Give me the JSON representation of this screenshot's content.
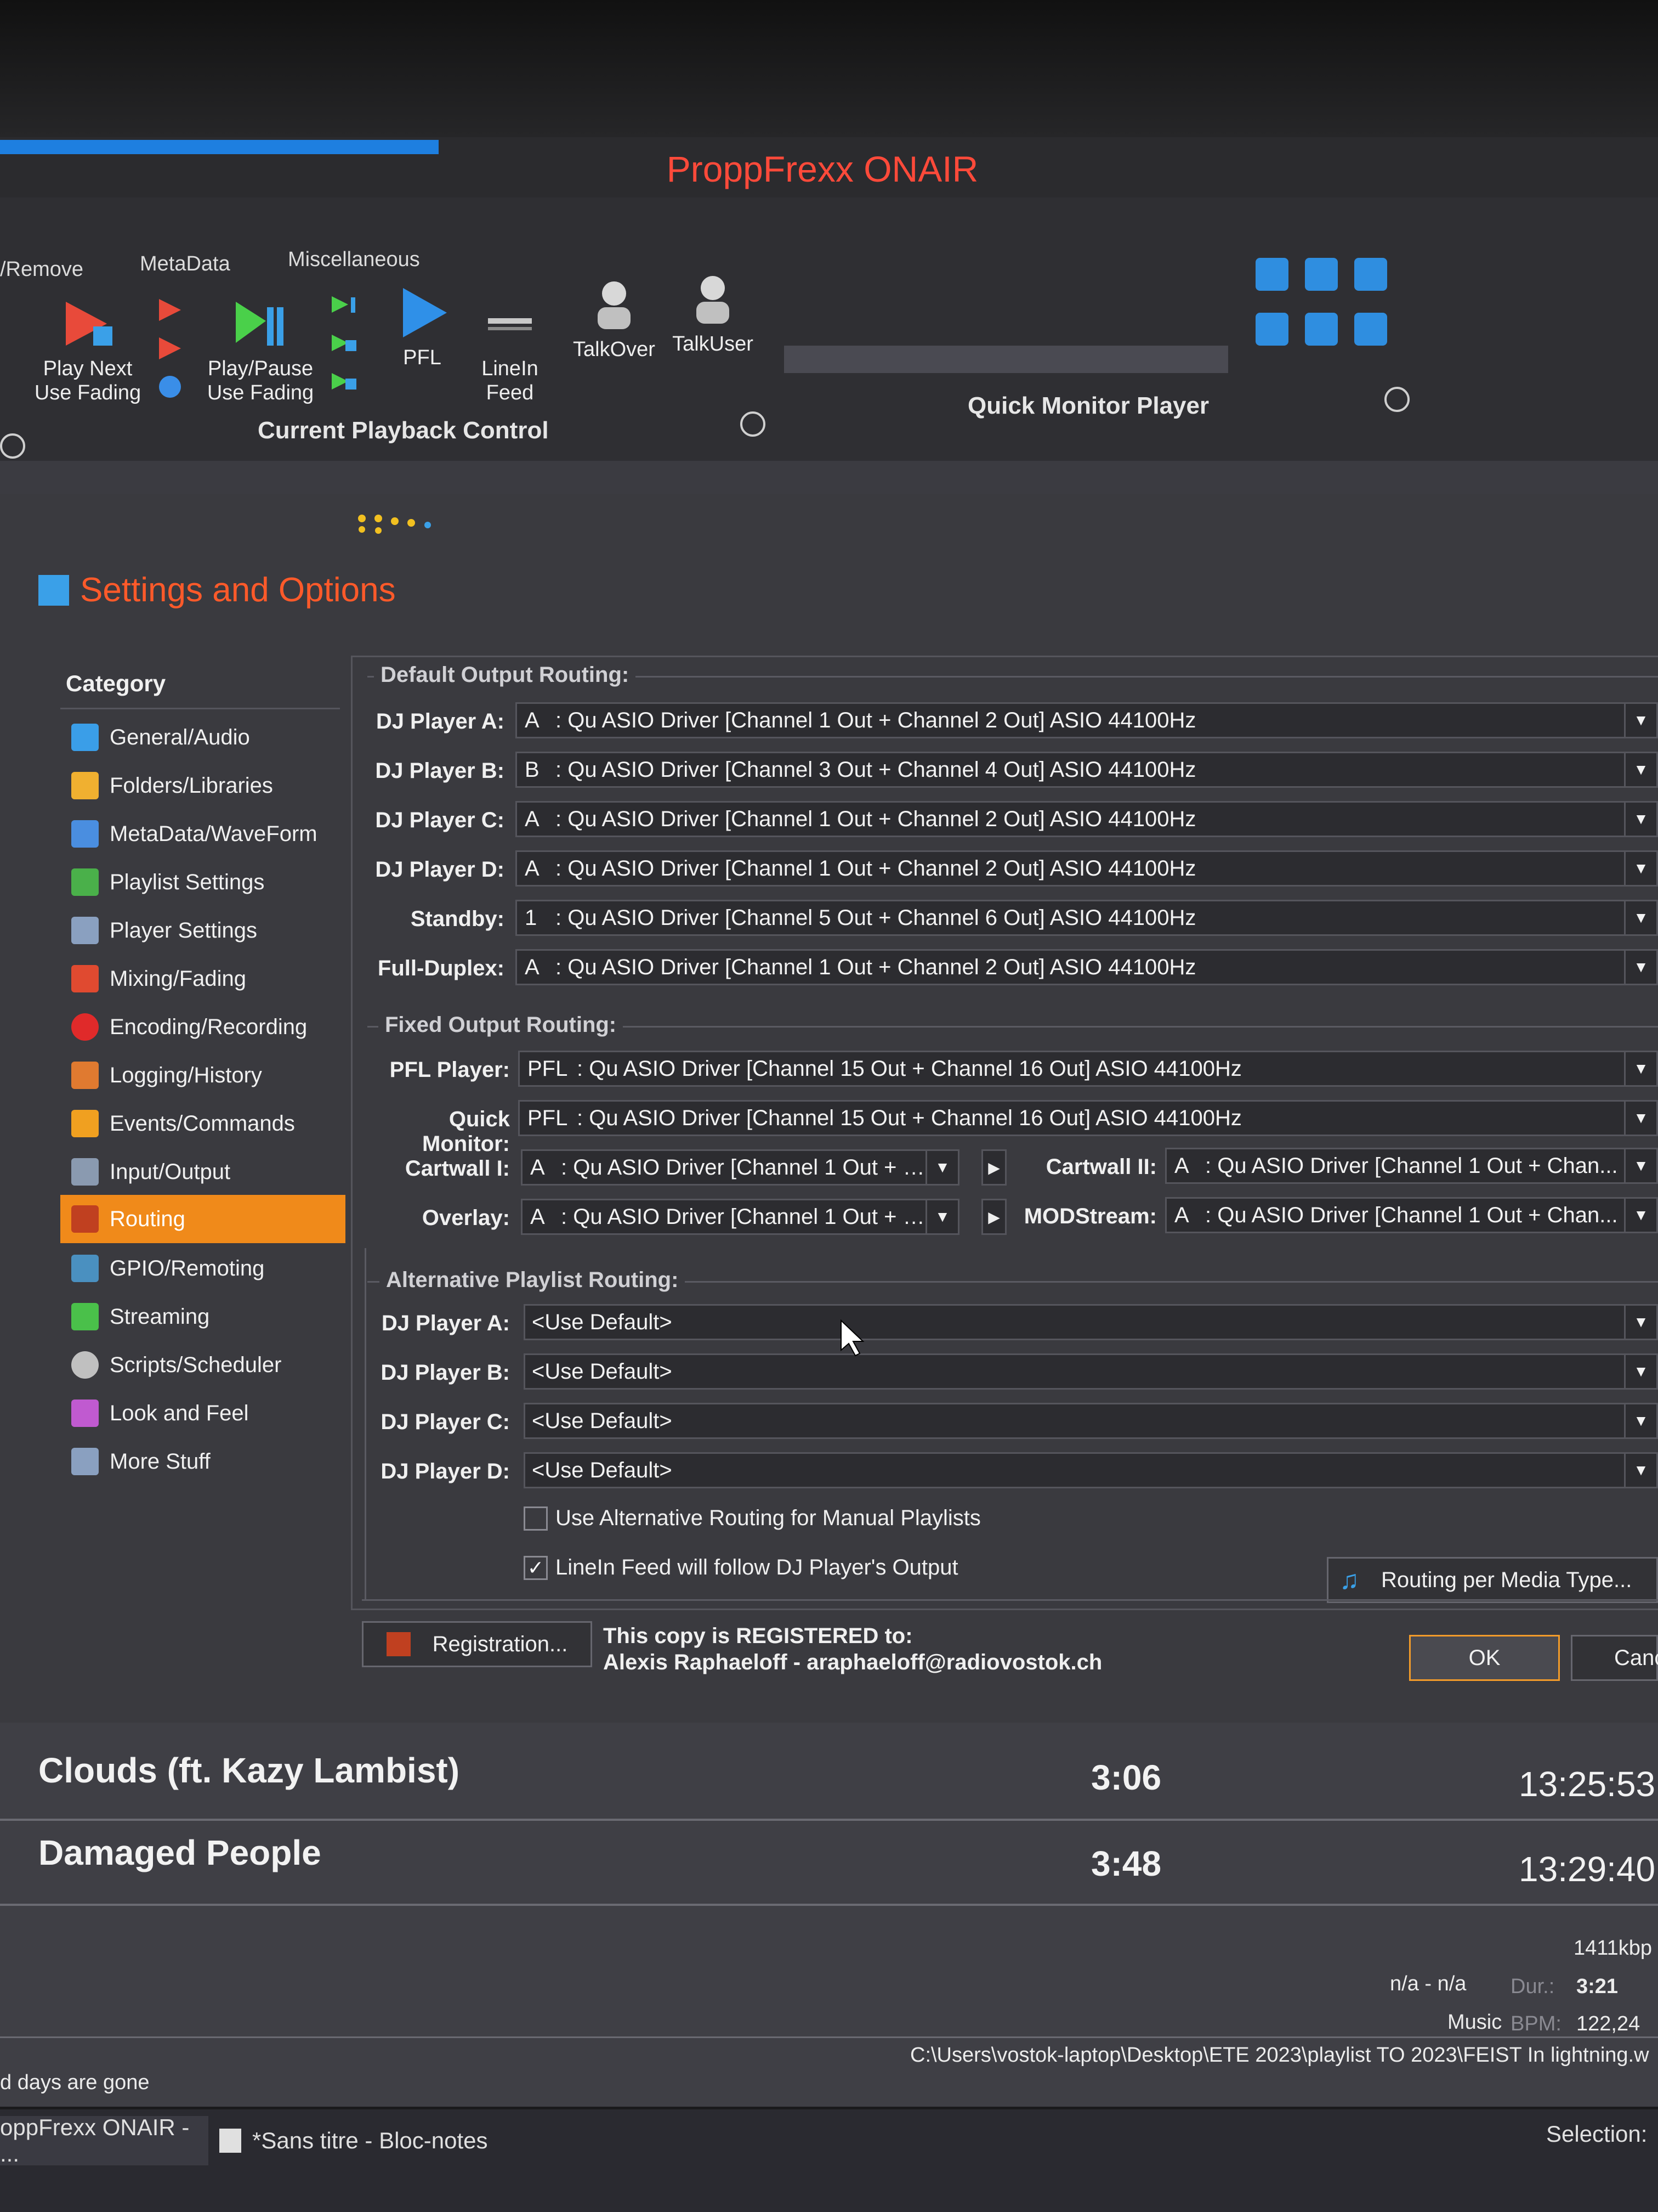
{
  "window": {
    "title": "ProppFrexx ONAIR"
  },
  "ribbon": {
    "group_labels": {
      "remove": "/Remove",
      "metadata": "MetaData",
      "misc": "Miscellaneous"
    },
    "buttons": {
      "play_next": "Play Next\nUse Fading",
      "play_pause": "Play/Pause\nUse Fading",
      "pfl": "PFL",
      "linein": "LineIn\nFeed",
      "talkover": "TalkOver",
      "talkuser": "TalkUser"
    },
    "sections": {
      "playback": "Current Playback Control",
      "monitor": "Quick Monitor Player"
    }
  },
  "settings": {
    "title": "Settings and Options",
    "category_header": "Category",
    "categories": [
      {
        "label": "General/Audio",
        "color": "#3a9ee8"
      },
      {
        "label": "Folders/Libraries",
        "color": "#f0b030"
      },
      {
        "label": "MetaData/WaveForm",
        "color": "#4a8ee0"
      },
      {
        "label": "Playlist Settings",
        "color": "#4ab04a"
      },
      {
        "label": "Player Settings",
        "color": "#8aa0c0"
      },
      {
        "label": "Mixing/Fading",
        "color": "#e04a30"
      },
      {
        "label": "Encoding/Recording",
        "color": "#e02a2a"
      },
      {
        "label": "Logging/History",
        "color": "#e07a30"
      },
      {
        "label": "Events/Commands",
        "color": "#f0a020"
      },
      {
        "label": "Input/Output",
        "color": "#8a9ab0"
      },
      {
        "label": "Routing",
        "color": "#c04020"
      },
      {
        "label": "GPIO/Remoting",
        "color": "#4a90c0"
      },
      {
        "label": "Streaming",
        "color": "#4ac04a"
      },
      {
        "label": "Scripts/Scheduler",
        "color": "#c0c0c0"
      },
      {
        "label": "Look and Feel",
        "color": "#c05ad0"
      },
      {
        "label": "More Stuff",
        "color": "#8aa0c0"
      }
    ],
    "active_category": "Routing",
    "default_output": {
      "title": "Default Output Routing:",
      "rows": [
        {
          "label": "DJ Player A:",
          "channel": "A",
          "value": ": Qu ASIO Driver [Channel 1 Out + Channel 2 Out] ASIO 44100Hz"
        },
        {
          "label": "DJ Player B:",
          "channel": "B",
          "value": ": Qu ASIO Driver [Channel 3 Out + Channel 4 Out] ASIO 44100Hz"
        },
        {
          "label": "DJ Player C:",
          "channel": "A",
          "value": ": Qu ASIO Driver [Channel 1 Out + Channel 2 Out] ASIO 44100Hz"
        },
        {
          "label": "DJ Player D:",
          "channel": "A",
          "value": ": Qu ASIO Driver [Channel 1 Out + Channel 2 Out] ASIO 44100Hz"
        },
        {
          "label": "Standby:",
          "channel": "1",
          "value": ": Qu ASIO Driver [Channel 5 Out + Channel 6 Out] ASIO 44100Hz"
        },
        {
          "label": "Full-Duplex:",
          "channel": "A",
          "value": ": Qu ASIO Driver [Channel 1 Out + Channel 2 Out] ASIO 44100Hz"
        }
      ]
    },
    "fixed_output": {
      "title": "Fixed Output Routing:",
      "pfl_label": "PFL Player:",
      "pfl_channel": "PFL",
      "pfl_value": ": Qu ASIO Driver [Channel 15 Out + Channel 16 Out] ASIO 44100Hz",
      "qm_label": "Quick Monitor:",
      "qm_channel": "PFL",
      "qm_value": ": Qu ASIO Driver [Channel 15 Out + Channel 16 Out] ASIO 44100Hz",
      "cart1_label": "Cartwall I:",
      "cart1_channel": "A",
      "cart1_value": ": Qu ASIO Driver [Channel 1 Out + Chan...",
      "cart2_label": "Cartwall II:",
      "cart2_channel": "A",
      "cart2_value": ": Qu ASIO Driver [Channel 1 Out + Chan...",
      "overlay_label": "Overlay:",
      "overlay_channel": "A",
      "overlay_value": ": Qu ASIO Driver [Channel 1 Out + Chan...",
      "mod_label": "MODStream:",
      "mod_channel": "A",
      "mod_value": ": Qu ASIO Driver [Channel 1 Out + Chan..."
    },
    "alt_playlist": {
      "title": "Alternative Playlist Routing:",
      "rows": [
        {
          "label": "DJ Player A:",
          "value": "<Use Default>"
        },
        {
          "label": "DJ Player B:",
          "value": "<Use Default>"
        },
        {
          "label": "DJ Player C:",
          "value": "<Use Default>"
        },
        {
          "label": "DJ Player D:",
          "value": "<Use Default>"
        }
      ],
      "chk_manual": "Use Alternative Routing for Manual Playlists",
      "chk_manual_checked": false,
      "chk_linein": "LineIn Feed will follow DJ Player's Output",
      "chk_linein_checked": true,
      "media_btn": "Routing per Media Type..."
    },
    "footer": {
      "registration_btn": "Registration...",
      "reg_line1": "This copy is REGISTERED to:",
      "reg_line2": "Alexis Raphaeloff - araphaeloff@radiovostok.ch",
      "ok": "OK",
      "cancel": "Canc"
    }
  },
  "playlist": {
    "items": [
      {
        "title": "Clouds (ft. Kazy Lambist)",
        "duration": "3:06",
        "time": "13:25:53"
      },
      {
        "title": "Damaged People",
        "duration": "3:48",
        "time": "13:29:40"
      }
    ],
    "info": {
      "bitrate": "1411kbp",
      "na": "n/a - n/a",
      "dur_label": "Dur.:",
      "dur_value": "3:21",
      "music": "Music",
      "bpm_label": "BPM:",
      "bpm_value": "122,24",
      "path": "C:\\Users\\vostok-laptop\\Desktop\\ETE 2023\\playlist TO 2023\\FEIST In lightning.w",
      "left_status": "d days are gone"
    }
  },
  "taskbar": {
    "task1": "oppFrexx ONAIR - ...",
    "task2": "*Sans titre - Bloc-notes",
    "selection": "Selection: "
  }
}
